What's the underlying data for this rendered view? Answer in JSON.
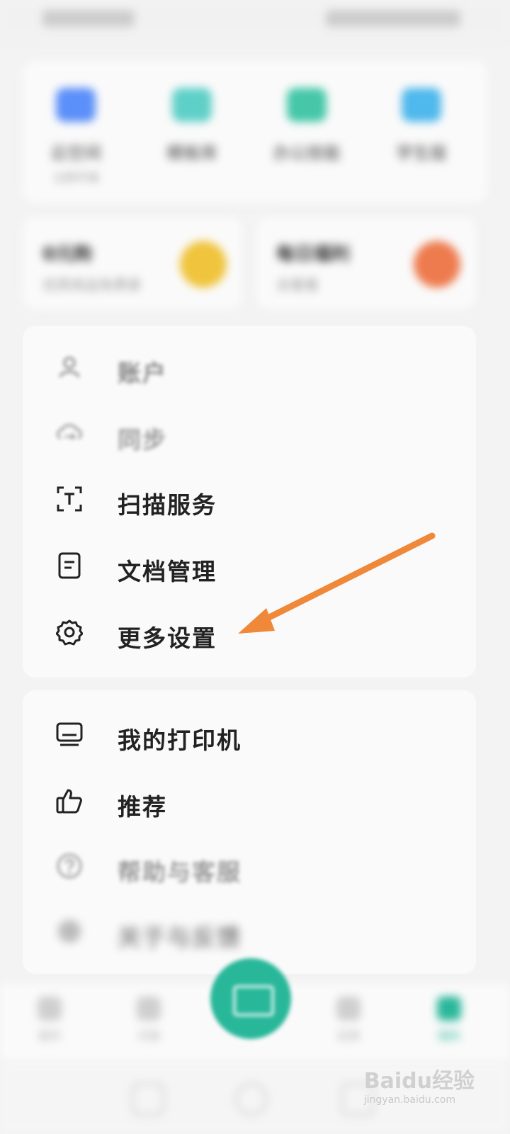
{
  "quick_row": [
    {
      "label": "云空间",
      "sub": "立即开通",
      "color": "#5b8ff9"
    },
    {
      "label": "模板库",
      "sub": "",
      "color": "#5fd0c8"
    },
    {
      "label": "办公技能",
      "sub": "",
      "color": "#45c7a8"
    },
    {
      "label": "学生版",
      "sub": "",
      "color": "#4fb8ec"
    }
  ],
  "promo_cards": [
    {
      "title": "0元购",
      "sub": "优质商品免费拿",
      "badge_color": "#f0c43c"
    },
    {
      "title": "每日福利",
      "sub": "去看看",
      "badge_color": "#ee7b4e"
    }
  ],
  "menu_group_1": [
    {
      "label": "账户",
      "icon": "user-icon",
      "blurred": true
    },
    {
      "label": "同步",
      "icon": "sync-icon",
      "blurred": true
    },
    {
      "label": "扫描服务",
      "icon": "scan-text-icon",
      "blurred": false
    },
    {
      "label": "文档管理",
      "icon": "document-icon",
      "blurred": false
    },
    {
      "label": "更多设置",
      "icon": "gear-icon",
      "blurred": false
    }
  ],
  "menu_group_2": [
    {
      "label": "我的打印机",
      "icon": "printer-icon",
      "blurred": false
    },
    {
      "label": "推荐",
      "icon": "thumbs-up-icon",
      "blurred": false
    },
    {
      "label": "帮助与客服",
      "icon": "help-icon",
      "blurred": true
    },
    {
      "label": "关于与反馈",
      "icon": "info-icon",
      "blurred": true
    }
  ],
  "bottom_nav": [
    {
      "label": "首页",
      "active": false
    },
    {
      "label": "文档",
      "active": false
    },
    {
      "label": "应用",
      "active": false
    },
    {
      "label": "我的",
      "active": true
    }
  ],
  "colors": {
    "accent": "#29b79a",
    "arrow": "#f0883a"
  },
  "watermark": {
    "main": "Baidu经验",
    "sub": "jingyan.baidu.com"
  }
}
